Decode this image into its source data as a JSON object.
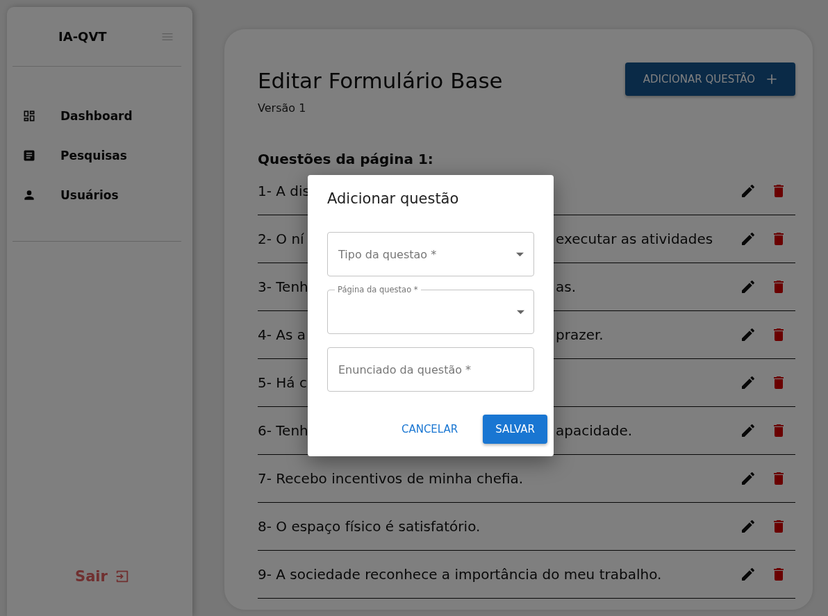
{
  "sidebar": {
    "brand": "IA-QVT",
    "items": [
      {
        "label": "Dashboard"
      },
      {
        "label": "Pesquisas"
      },
      {
        "label": "Usuários"
      }
    ],
    "logout": "Sair"
  },
  "editor": {
    "title": "Editar Formulário Base",
    "subtitle": "Versão 1",
    "add_button": "ADICIONAR QUESTÃO",
    "section_heading": "Questões da página 1:",
    "questions": [
      {
        "text_left": "1- A dis"
      },
      {
        "text_left": "2- O ní",
        "text_right": "executar as atividades"
      },
      {
        "text_left": "3- Tenh",
        "text_right": "as."
      },
      {
        "text_left": "4- As a",
        "text_right": "prazer."
      },
      {
        "text_left": "5- Há c"
      },
      {
        "text_left": "6- Tenh",
        "text_right": "apacidade."
      },
      {
        "text_left": "7- Recebo incentivos de minha chefia."
      },
      {
        "text_left": "8- O espaço físico é satisfatório."
      },
      {
        "text_left": "9- A sociedade reconhece a importância do meu trabalho."
      }
    ]
  },
  "dialog": {
    "title": "Adicionar questão",
    "fields": [
      {
        "kind": "select",
        "label": "Tipo da questao *",
        "floating": false
      },
      {
        "kind": "select",
        "label": "Página da questao *",
        "floating": true
      },
      {
        "kind": "text",
        "label": "Enunciado da questão *",
        "floating": false
      }
    ],
    "buttons": [
      {
        "label": "CANCELAR",
        "kind": "text"
      },
      {
        "label": "SALVAR",
        "kind": "contained"
      }
    ]
  }
}
